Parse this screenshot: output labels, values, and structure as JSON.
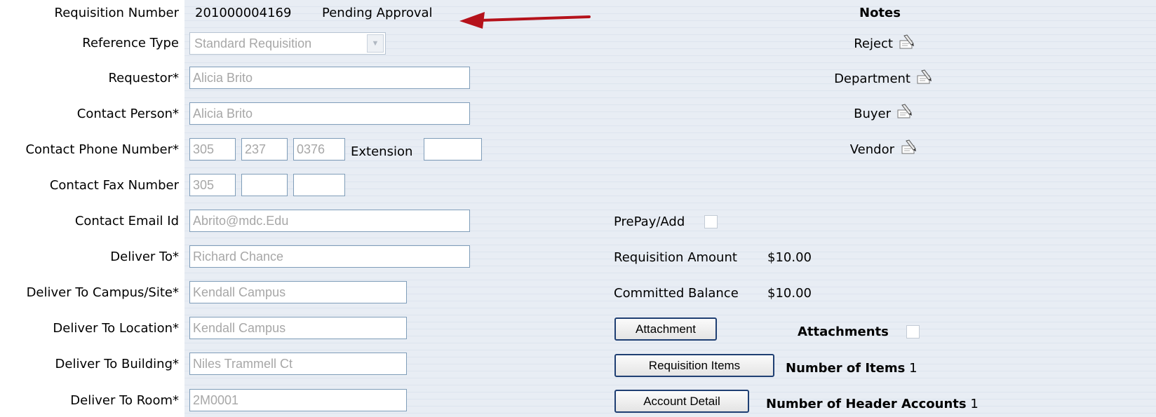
{
  "requisition": {
    "number_label": "Requisition Number",
    "number": "201000004169",
    "status": "Pending Approval"
  },
  "form": {
    "reference_type": {
      "label": "Reference Type",
      "value": "Standard Requisition"
    },
    "requestor": {
      "label": "Requestor*",
      "value": "Alicia Brito"
    },
    "contact_person": {
      "label": "Contact Person*",
      "value": "Alicia Brito"
    },
    "contact_phone": {
      "label": "Contact Phone Number*",
      "area": "305",
      "prefix": "237",
      "line": "0376",
      "extension_label": "Extension",
      "extension": ""
    },
    "contact_fax": {
      "label": "Contact Fax Number",
      "area": "305",
      "prefix": "",
      "line": ""
    },
    "contact_email": {
      "label": "Contact Email Id",
      "value": "Abrito@mdc.Edu"
    },
    "deliver_to": {
      "label": "Deliver To*",
      "value": "Richard Chance"
    },
    "deliver_campus": {
      "label": "Deliver To Campus/Site*",
      "value": "Kendall Campus"
    },
    "deliver_location": {
      "label": "Deliver To Location*",
      "value": "Kendall Campus"
    },
    "deliver_building": {
      "label": "Deliver To Building*",
      "value": "Niles Trammell Ct"
    },
    "deliver_room": {
      "label": "Deliver To Room*",
      "value": "2M0001"
    }
  },
  "notes": {
    "title": "Notes",
    "items": [
      {
        "label": "Reject",
        "icon": "note-pencil-icon"
      },
      {
        "label": "Department",
        "icon": "note-pencil-icon"
      },
      {
        "label": "Buyer",
        "icon": "note-pencil-icon"
      },
      {
        "label": "Vendor",
        "icon": "note-pencil-icon"
      }
    ]
  },
  "summary": {
    "prepay_label": "PrePay/Add",
    "prepay_checked": false,
    "amount_label": "Requisition Amount",
    "amount": "$10.00",
    "committed_label": "Committed Balance",
    "committed": "$10.00",
    "attachment_button": "Attachment",
    "attachments_label": "Attachments",
    "attachments_checked": false,
    "items_button": "Requisition Items",
    "items_count_label": "Number of Items",
    "items_count": "1",
    "account_button": "Account Detail",
    "accounts_count_label": "Number of Header Accounts",
    "accounts_count": "1"
  },
  "colors": {
    "panel_bg": "#e8edf4",
    "input_border": "#7f9db9",
    "placeholder_text": "#a7a7a7",
    "arrow": "#b5121b"
  }
}
